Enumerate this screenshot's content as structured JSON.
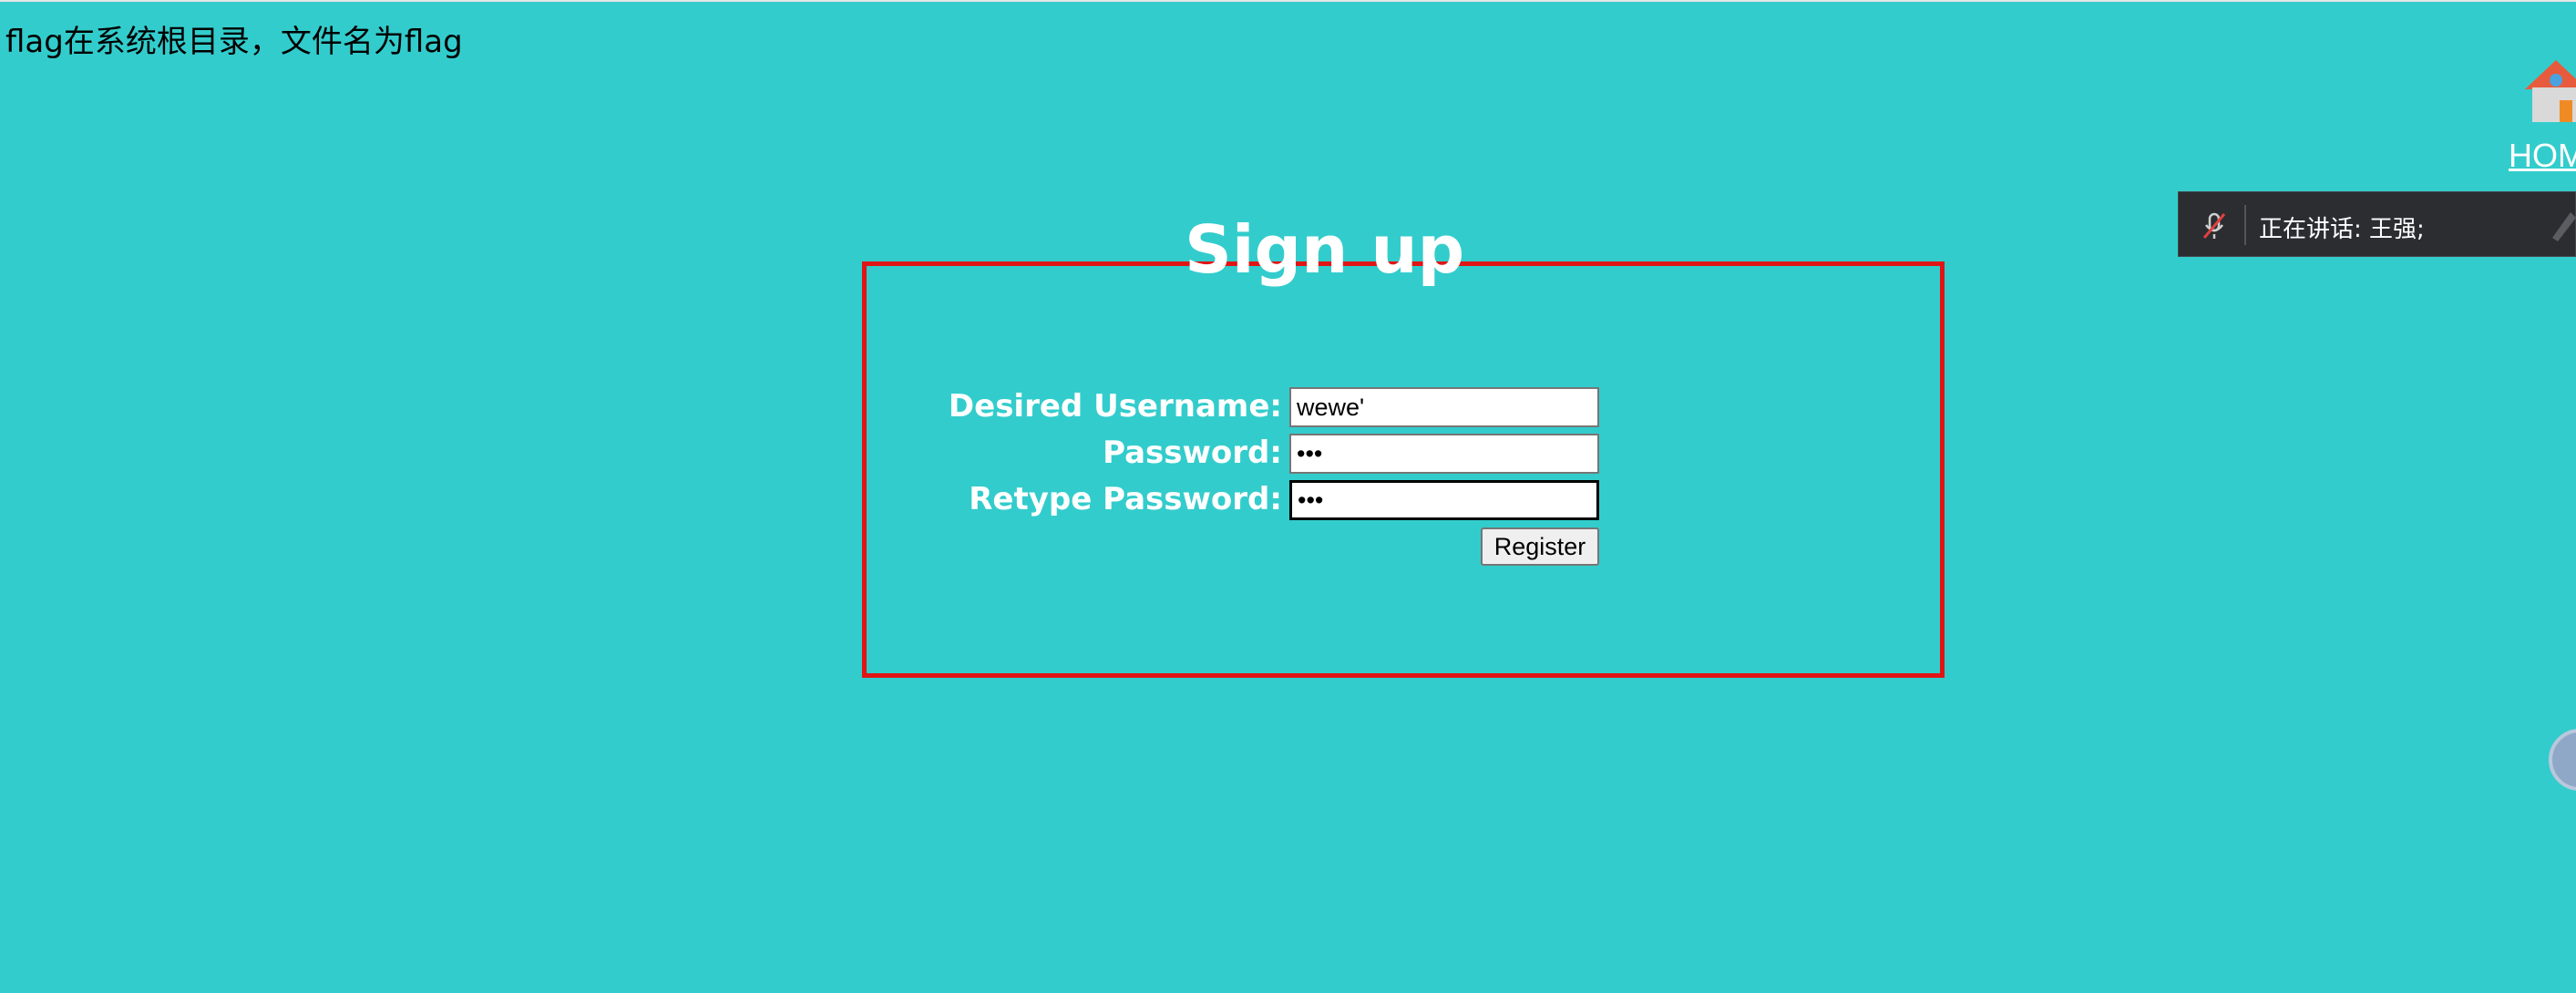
{
  "hint": "flag在系统根目录，文件名为flag",
  "nav": {
    "home_label": "HOME"
  },
  "form": {
    "title": "Sign up",
    "username_label": "Desired Username:",
    "username_value": "wewe'",
    "password_label": "Password:",
    "password_value": "abc",
    "retype_label": "Retype Password:",
    "retype_value": "abc",
    "register_label": "Register"
  },
  "voice_bar": {
    "speaking_text": "正在讲话:   王强;"
  },
  "colors": {
    "background": "#33cccc",
    "frame": "#e01515",
    "text": "#ffffff"
  }
}
